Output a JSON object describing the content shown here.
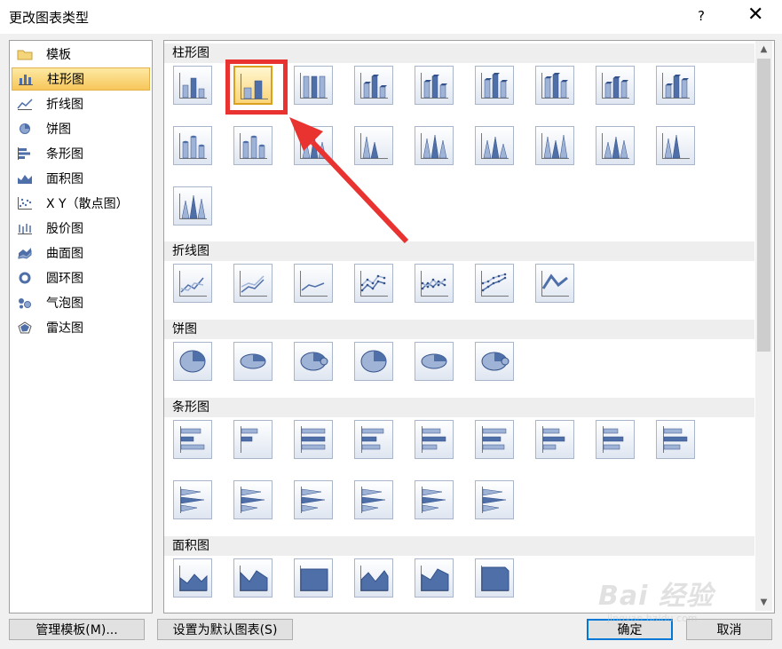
{
  "window": {
    "title": "更改图表类型",
    "help": "?",
    "close": "✕"
  },
  "sidebar": {
    "items": [
      {
        "label": "模板",
        "icon": "folder-icon"
      },
      {
        "label": "柱形图",
        "icon": "column-chart-icon",
        "selected": true
      },
      {
        "label": "折线图",
        "icon": "line-chart-icon"
      },
      {
        "label": "饼图",
        "icon": "pie-chart-icon"
      },
      {
        "label": "条形图",
        "icon": "bar-chart-icon"
      },
      {
        "label": "面积图",
        "icon": "area-chart-icon"
      },
      {
        "label": "X Y（散点图）",
        "icon": "scatter-chart-icon"
      },
      {
        "label": "股价图",
        "icon": "stock-chart-icon"
      },
      {
        "label": "曲面图",
        "icon": "surface-chart-icon"
      },
      {
        "label": "圆环图",
        "icon": "doughnut-chart-icon"
      },
      {
        "label": "气泡图",
        "icon": "bubble-chart-icon"
      },
      {
        "label": "雷达图",
        "icon": "radar-chart-icon"
      }
    ]
  },
  "sections": [
    {
      "label": "柱形图",
      "count": 19
    },
    {
      "label": "折线图",
      "count": 7
    },
    {
      "label": "饼图",
      "count": 6
    },
    {
      "label": "条形图",
      "count": 15
    },
    {
      "label": "面积图",
      "count": 6
    }
  ],
  "selected_thumb": "柱形图-2",
  "buttons": {
    "manage_templates": "管理模板(M)...",
    "set_default": "设置为默认图表(S)",
    "ok": "确定",
    "cancel": "取消"
  },
  "watermark": {
    "main": "Bai 经验",
    "sub": "jingyan.baidu.com"
  },
  "colors": {
    "selection": "#f7c65a",
    "annotation_red": "#e83331",
    "thumb_blue": "#4f6fa8"
  }
}
